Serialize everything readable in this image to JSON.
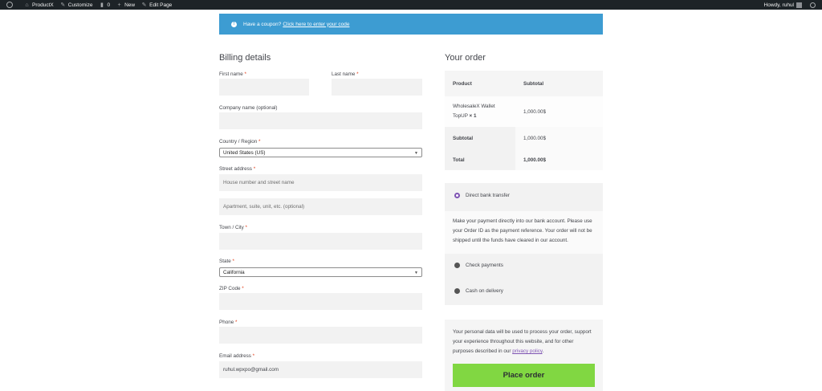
{
  "adminbar": {
    "site": "ProductX",
    "customize": "Customize",
    "comments": "0",
    "new": "New",
    "edit": "Edit Page",
    "howdy": "Howdy, ruhul"
  },
  "coupon": {
    "text": "Have a coupon?",
    "link": "Click here to enter your code"
  },
  "billing": {
    "title": "Billing details",
    "first_name": "First name",
    "last_name": "Last name",
    "company": "Company name (optional)",
    "country": "Country / Region",
    "country_value": "United States (US)",
    "street": "Street address",
    "street_placeholder": "House number and street name",
    "apt_placeholder": "Apartment, suite, unit, etc. (optional)",
    "town": "Town / City",
    "state": "State",
    "state_value": "California",
    "zip": "ZIP Code",
    "phone": "Phone",
    "email": "Email address",
    "email_value": "ruhul.wpxpo@gmail.com",
    "required_mark": "*"
  },
  "order": {
    "title": "Your order",
    "col_product": "Product",
    "col_subtotal": "Subtotal",
    "item_name_1": "WholesaleX Wallet",
    "item_name_2": "TopUP",
    "item_qty": "× 1",
    "item_price": "1,000.00$",
    "subtotal_label": "Subtotal",
    "subtotal_value": "1,000.00$",
    "total_label": "Total",
    "total_value": "1,000.00$"
  },
  "payment": {
    "direct": "Direct bank transfer",
    "direct_desc": "Make your payment directly into our bank account. Please use your Order ID as the payment reference. Your order will not be shipped until the funds have cleared in our account.",
    "check": "Check payments",
    "cod": "Cash on delivery"
  },
  "privacy": {
    "text": "Your personal data will be used to process your order, support your experience throughout this website, and for other purposes described in our",
    "link": "privacy policy",
    "end": "."
  },
  "place_order": "Place order",
  "colors": {
    "coupon_bg": "#3d9cd2",
    "button_bg": "#81d742",
    "required": "#e2401c",
    "radio_on": "#7f54b3"
  }
}
